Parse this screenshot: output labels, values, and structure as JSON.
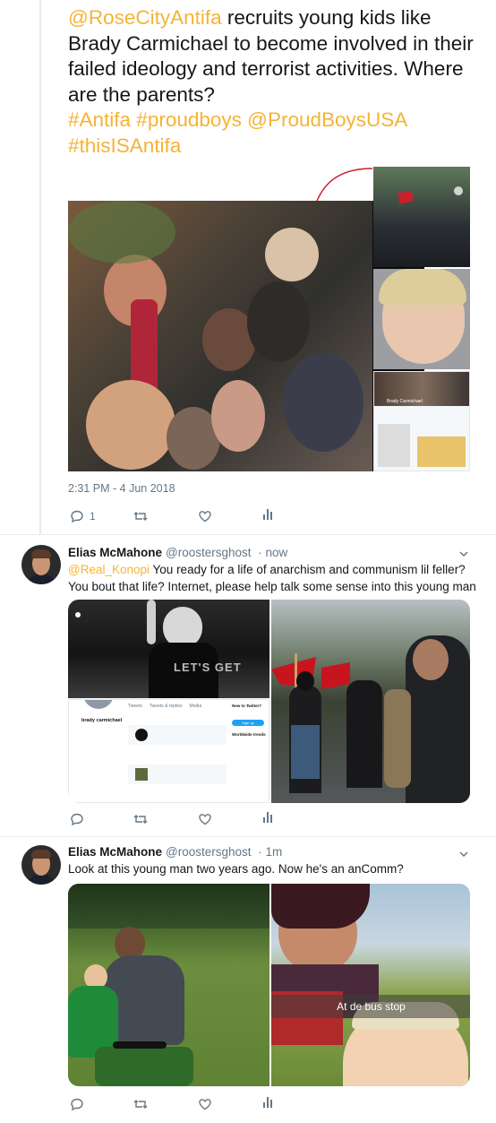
{
  "tweet1": {
    "text_mention": "@RoseCityAntifa",
    "text_body": "recruits young kids like Brady Carmichael to become involved in their failed ideology and terrorist activities.  Where are the parents?",
    "hashtags_line1": "#Antifa #proudboys @ProudBoysUSA",
    "hashtags_line2": "#thisISAntifa",
    "timestamp": "2:31 PM - 4 Jun 2018",
    "reply_count": "1",
    "media_thumb_text": "Brady Carmichael"
  },
  "tweet2": {
    "name": "Elias McMahone",
    "handle": "@roostersghost",
    "time": "· now",
    "mention": "@Real_Konopi",
    "text_line1": "You ready for a life of anarchism and communism lil feller?",
    "text_line2": "You bout that life?  Internet, please help talk some sense into this young man",
    "profile_card": {
      "name": "brady carmichael",
      "tabs": [
        "Tweets",
        "Tweets & replies",
        "Media"
      ],
      "sidebar_title": "New to Twitter?",
      "signup": "Sign up",
      "trends_title": "Worldwide trends",
      "shirt_text": "LET'S GET"
    }
  },
  "tweet3": {
    "name": "Elias McMahone",
    "handle": "@roostersghost",
    "time": "· 1m",
    "text": "Look at this young man two years ago.  Now he's an anComm?",
    "snap_caption": "At de bus stop"
  },
  "colors": {
    "accent": "#f5b335",
    "secondary_text": "#657786",
    "divider": "#e6ecf0"
  },
  "icons": [
    "reply-icon",
    "retweet-icon",
    "like-icon",
    "analytics-icon",
    "chevron-down-icon"
  ]
}
